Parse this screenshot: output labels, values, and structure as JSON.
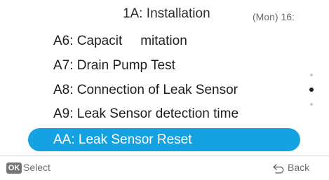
{
  "header": {
    "title": "1A: Installation",
    "clock": "(Mon) 16:"
  },
  "menu": {
    "items": [
      {
        "label_a": "A6: Capacit",
        "label_b": "mitation",
        "selected": false
      },
      {
        "label": "A7: Drain Pump Test",
        "selected": false
      },
      {
        "label": "A8: Connection of Leak Sensor",
        "selected": false
      },
      {
        "label": "A9: Leak Sensor detection time",
        "selected": false
      },
      {
        "label": "AA: Leak Sensor Reset",
        "selected": true
      }
    ]
  },
  "scrollbar": {
    "dot_count": 3,
    "active_index": 1
  },
  "footer": {
    "ok_badge": "OK",
    "select_label": "Select",
    "back_label": "Back",
    "back_icon": "back-arrow-icon"
  },
  "colors": {
    "accent": "#15a2e3",
    "text": "#1e1e1e",
    "muted": "#6d6d6d"
  }
}
